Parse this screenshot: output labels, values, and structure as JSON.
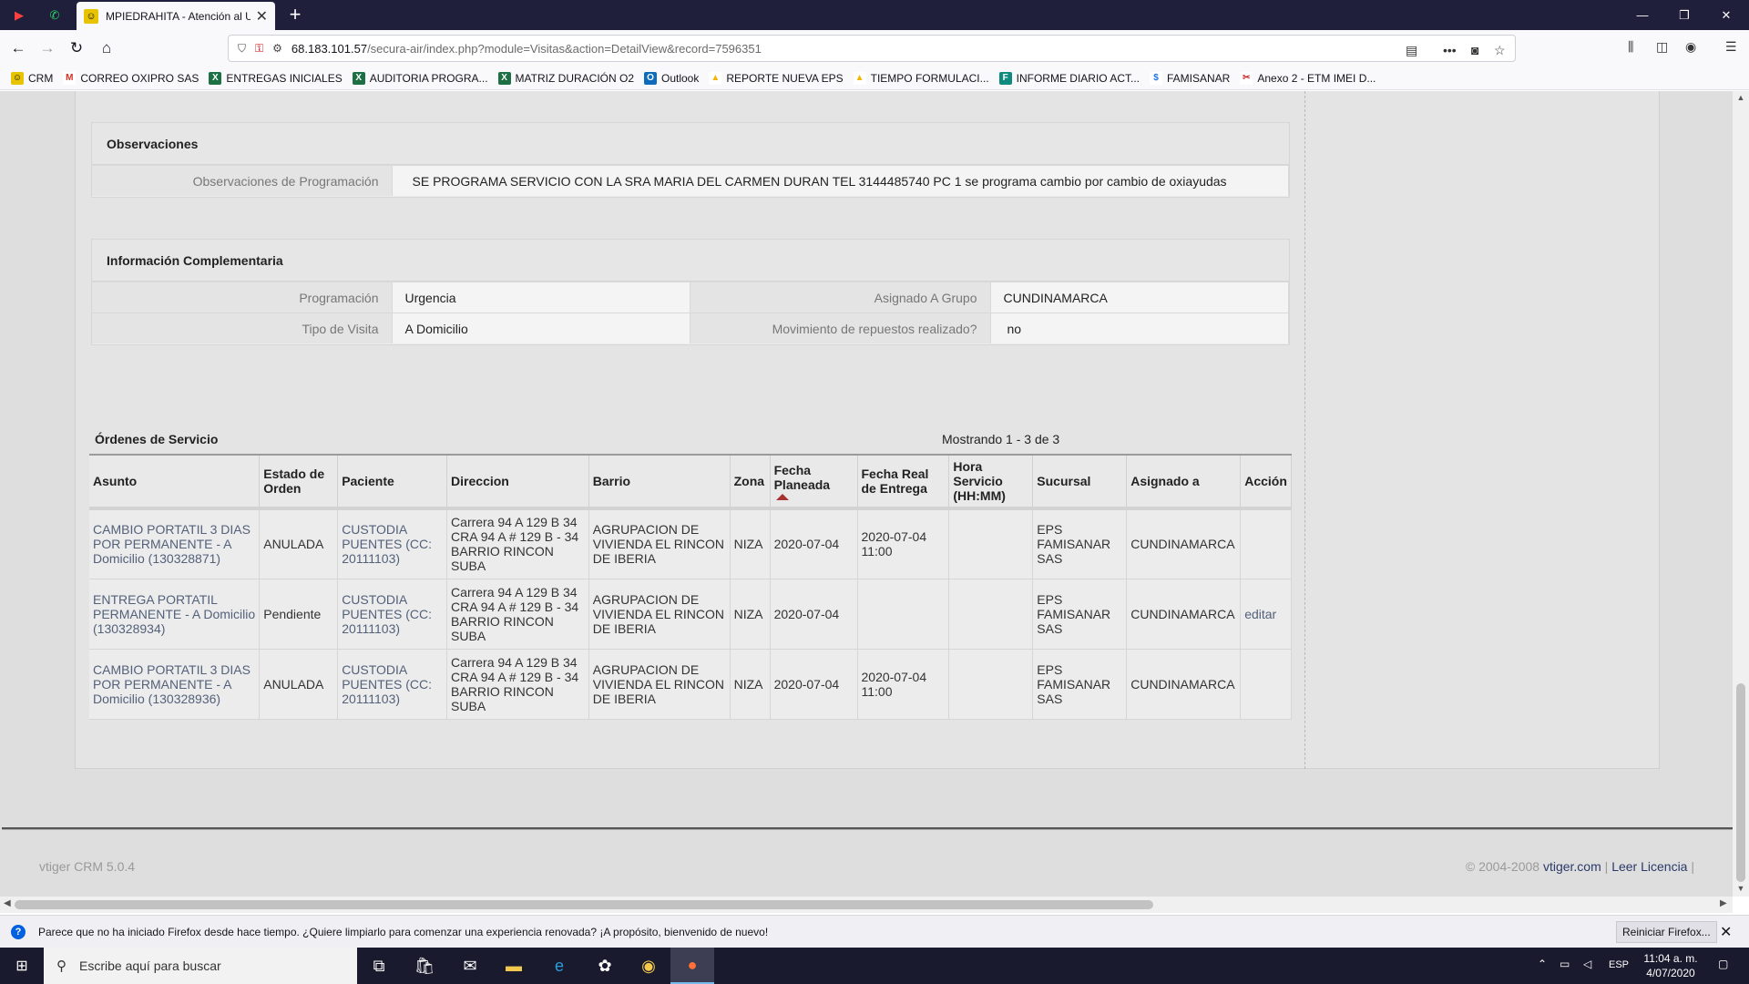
{
  "browser": {
    "tab_title": "MPIEDRAHITA - Atención al Us",
    "url_host": "68.183.101.57",
    "url_path": "/secura-air/index.php?module=Visitas&action=DetailView&record=7596351",
    "bookmarks": [
      {
        "label": "CRM",
        "icon": "crm-icon",
        "color": "#e8c400"
      },
      {
        "label": "CORREO OXIPRO SAS",
        "icon": "gmail-icon",
        "color": "#d93025"
      },
      {
        "label": "ENTREGAS INICIALES",
        "icon": "excel-icon",
        "color": "#1d7044"
      },
      {
        "label": "AUDITORIA PROGRA...",
        "icon": "excel-icon",
        "color": "#1d7044"
      },
      {
        "label": "MATRIZ DURACIÓN O2",
        "icon": "excel-icon",
        "color": "#1d7044"
      },
      {
        "label": "Outlook",
        "icon": "outlook-icon",
        "color": "#0f6cbd"
      },
      {
        "label": "REPORTE NUEVA EPS",
        "icon": "drive-icon",
        "color": "#f4b400"
      },
      {
        "label": "TIEMPO FORMULACI...",
        "icon": "drive-icon",
        "color": "#f4b400"
      },
      {
        "label": "INFORME DIARIO ACT...",
        "icon": "forms-icon",
        "color": "#0f8a7e"
      },
      {
        "label": "FAMISANAR",
        "icon": "famisanar-icon",
        "color": "#1a73e8"
      },
      {
        "label": "Anexo 2 - ETM IMEI D...",
        "icon": "scissor-icon",
        "color": "#c62828"
      }
    ]
  },
  "observaciones": {
    "heading": "Observaciones",
    "label": "Observaciones de Programación",
    "value": "SE PROGRAMA SERVICIO CON LA SRA MARIA DEL CARMEN DURAN TEL 3144485740 PC 1 se programa cambio por cambio de oxiayudas"
  },
  "info": {
    "heading": "Información Complementaria",
    "programacion_label": "Programación",
    "programacion_value": "Urgencia",
    "grupo_label": "Asignado A Grupo",
    "grupo_value": "CUNDINAMARCA",
    "tipo_label": "Tipo de Visita",
    "tipo_value": "A Domicilio",
    "movimiento_label": "Movimiento de repuestos realizado?",
    "movimiento_value": "no"
  },
  "ordenes": {
    "title": "Órdenes de Servicio",
    "showing": "Mostrando 1 - 3 de 3",
    "headers": {
      "asunto": "Asunto",
      "estado": "Estado de Orden",
      "paciente": "Paciente",
      "direccion": "Direccion",
      "barrio": "Barrio",
      "zona": "Zona",
      "fecha_planeada": "Fecha Planeada",
      "fecha_real": "Fecha Real de Entrega",
      "hora": "Hora Servicio (HH:MM)",
      "sucursal": "Sucursal",
      "asignado": "Asignado a",
      "accion": "Acción"
    },
    "rows": [
      {
        "asunto": "CAMBIO PORTATIL 3 DIAS POR PERMANENTE - A Domicilio (130328871)",
        "estado": "ANULADA",
        "paciente": "CUSTODIA PUENTES (CC: 20111103)",
        "direccion": "Carrera 94 A 129 B 34 CRA 94 A # 129 B - 34 BARRIO RINCON SUBA",
        "barrio": "AGRUPACION DE VIVIENDA EL RINCON DE IBERIA",
        "zona": "NIZA",
        "fecha_planeada": "2020-07-04",
        "fecha_real": "2020-07-04 11:00",
        "hora": "",
        "sucursal": "EPS FAMISANAR SAS",
        "asignado": "CUNDINAMARCA",
        "accion": ""
      },
      {
        "asunto": "ENTREGA PORTATIL PERMANENTE - A Domicilio (130328934)",
        "estado": "Pendiente",
        "paciente": "CUSTODIA PUENTES (CC: 20111103)",
        "direccion": "Carrera 94 A 129 B 34 CRA 94 A # 129 B - 34 BARRIO RINCON SUBA",
        "barrio": "AGRUPACION DE VIVIENDA EL RINCON DE IBERIA",
        "zona": "NIZA",
        "fecha_planeada": "2020-07-04",
        "fecha_real": "",
        "hora": "",
        "sucursal": "EPS FAMISANAR SAS",
        "asignado": "CUNDINAMARCA",
        "accion": "editar"
      },
      {
        "asunto": "CAMBIO PORTATIL 3 DIAS POR PERMANENTE - A Domicilio (130328936)",
        "estado": "ANULADA",
        "paciente": "CUSTODIA PUENTES (CC: 20111103)",
        "direccion": "Carrera 94 A 129 B 34 CRA 94 A # 129 B - 34 BARRIO RINCON SUBA",
        "barrio": "AGRUPACION DE VIVIENDA EL RINCON DE IBERIA",
        "zona": "NIZA",
        "fecha_planeada": "2020-07-04",
        "fecha_real": "2020-07-04 11:00",
        "hora": "",
        "sucursal": "EPS FAMISANAR SAS",
        "asignado": "CUNDINAMARCA",
        "accion": ""
      }
    ]
  },
  "footer": {
    "version": "vtiger CRM 5.0.4",
    "copyright": "© 2004-2008",
    "vtiger_link": "vtiger.com",
    "separator": "|",
    "licencia_link": "Leer Licencia",
    "trailing": "|"
  },
  "notification": {
    "message": "Parece que no ha iniciado Firefox desde hace tiempo. ¿Quiere limpiarlo para comenzar una experiencia renovada? ¡A propósito, bienvenido de nuevo!",
    "button": "Reiniciar Firefox..."
  },
  "taskbar": {
    "search_placeholder": "Escribe aquí para buscar",
    "lang": "ESP",
    "time": "11:04 a. m.",
    "date": "4/07/2020"
  }
}
